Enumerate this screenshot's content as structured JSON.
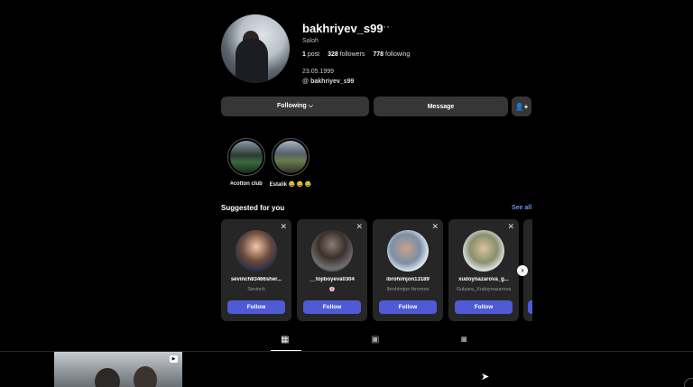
{
  "profile": {
    "username": "bakhriyev_s99",
    "more_icon": "ellipsis-icon",
    "full_name": "Saloh",
    "stats": {
      "posts_count": "1",
      "posts_label": "post",
      "followers_count": "328",
      "followers_label": "followers",
      "following_count": "778",
      "following_label": "following"
    },
    "bio": "23.05.1999",
    "threads_handle": "bakhriyev_s99"
  },
  "actions": {
    "following_label": "Following ⌵",
    "message_label": "Message",
    "add_user_icon": "add-user-icon"
  },
  "highlights": [
    {
      "label": "#cotton club"
    },
    {
      "label": "Estalik 😂 😂 😂"
    }
  ],
  "suggested": {
    "title": "Suggested for you",
    "see_all": "See all",
    "follow_label": "Follow",
    "cards": [
      {
        "username": "sevinch83466sher...",
        "subtitle": "Sevinch"
      },
      {
        "username": "__tojiboyeva0304",
        "subtitle": "🌸"
      },
      {
        "username": "ibrohimjon13189",
        "subtitle": "Ibrohimjon Ikromov"
      },
      {
        "username": "xudoynazarova_g...",
        "subtitle": "Gulyara_Xudoynazarova"
      }
    ]
  },
  "tabs": [
    {
      "name": "posts",
      "icon": "grid-icon"
    },
    {
      "name": "reels",
      "icon": "reels-icon"
    },
    {
      "name": "tagged",
      "icon": "tagged-icon"
    }
  ],
  "colors": {
    "background": "#000000",
    "button": "#363636",
    "follow_button": "#4f5bd5",
    "link": "#6e8ff5",
    "card": "#262626"
  }
}
